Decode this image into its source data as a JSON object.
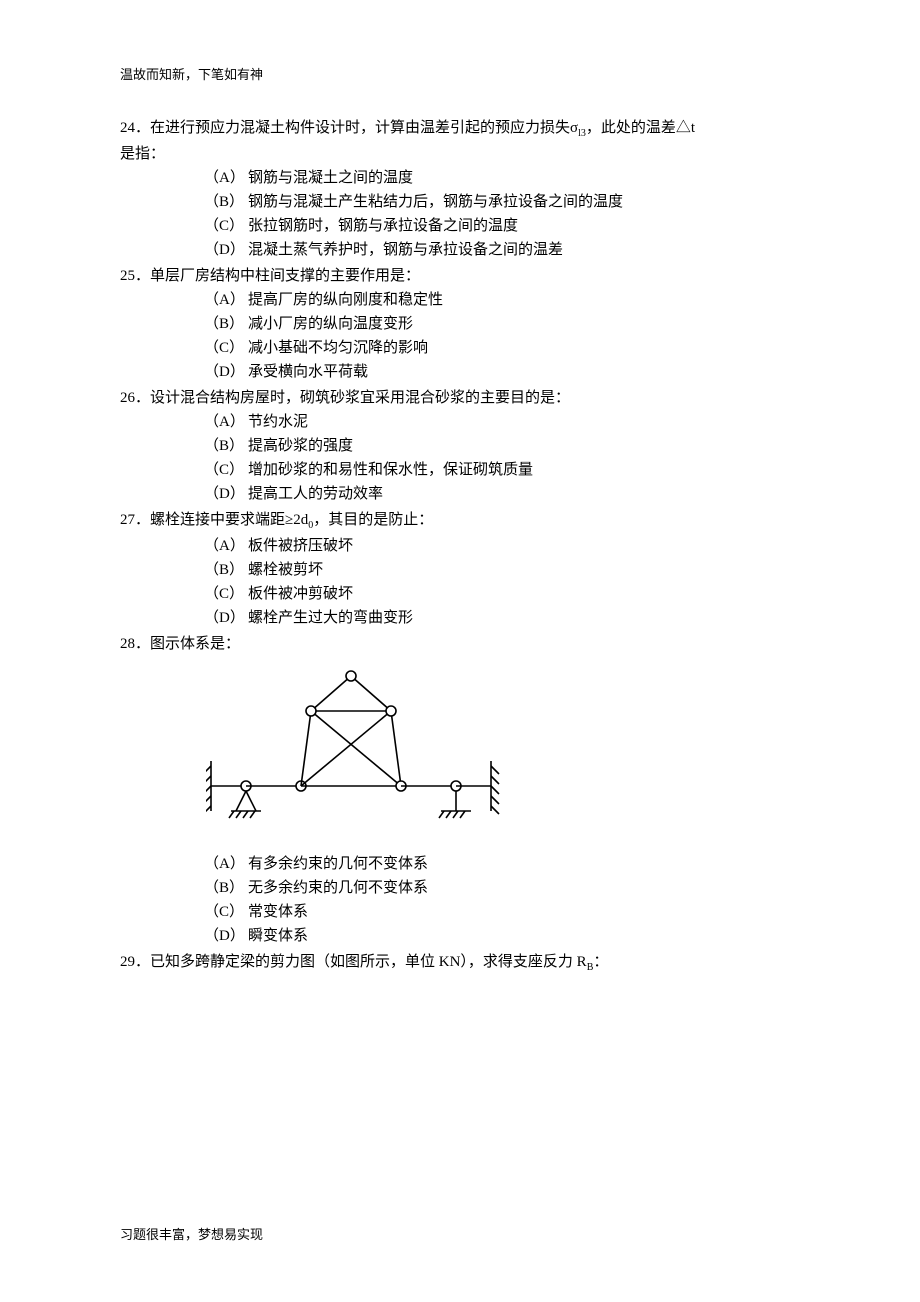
{
  "header": "温故而知新，下笔如有神",
  "footer": "习题很丰富，梦想易实现",
  "questions": [
    {
      "num": "24",
      "stem_pre": "．在进行预应力混凝土构件设计时，计算由温差引起的预应力损失σ",
      "stem_sub1": "l3",
      "stem_mid": "，此处的温差△t",
      "stem_line2": "是指：",
      "options": {
        "A": "钢筋与混凝土之间的温度",
        "B": "钢筋与混凝土产生粘结力后，钢筋与承拉设备之间的温度",
        "C": "张拉钢筋时，钢筋与承拉设备之间的温度",
        "D": "混凝土蒸气养护时，钢筋与承拉设备之间的温差"
      }
    },
    {
      "num": "25",
      "stem": "．单层厂房结构中柱间支撑的主要作用是：",
      "options": {
        "A": "提高厂房的纵向刚度和稳定性",
        "B": "减小厂房的纵向温度变形",
        "C": "减小基础不均匀沉降的影响",
        "D": "承受横向水平荷载"
      }
    },
    {
      "num": "26",
      "stem": "．设计混合结构房屋时，砌筑砂浆宜采用混合砂浆的主要目的是：",
      "options": {
        "A": "节约水泥",
        "B": "提高砂浆的强度",
        "C": "增加砂浆的和易性和保水性，保证砌筑质量",
        "D": "提高工人的劳动效率"
      }
    },
    {
      "num": "27",
      "stem_pre": "．螺栓连接中要求端距≥2d",
      "stem_sub1": "0",
      "stem_mid": "，其目的是防止：",
      "options": {
        "A": "板件被挤压破坏",
        "B": "螺栓被剪坏",
        "C": "板件被冲剪破坏",
        "D": "螺栓产生过大的弯曲变形"
      }
    },
    {
      "num": "28",
      "stem": "．图示体系是：",
      "has_figure": true,
      "options": {
        "A": "有多余约束的几何不变体系",
        "B": "无多余约束的几何不变体系",
        "C": "常变体系",
        "D": "瞬变体系"
      }
    },
    {
      "num": "29",
      "stem_pre": "．已知多跨静定梁的剪力图（如图所示，单位 KN），求得支座反力 R",
      "stem_sub1": "B",
      "stem_mid": "：",
      "options": null
    }
  ],
  "labels": {
    "A": "（A）",
    "B": "（B）",
    "C": "（C）",
    "D": "（D）"
  }
}
